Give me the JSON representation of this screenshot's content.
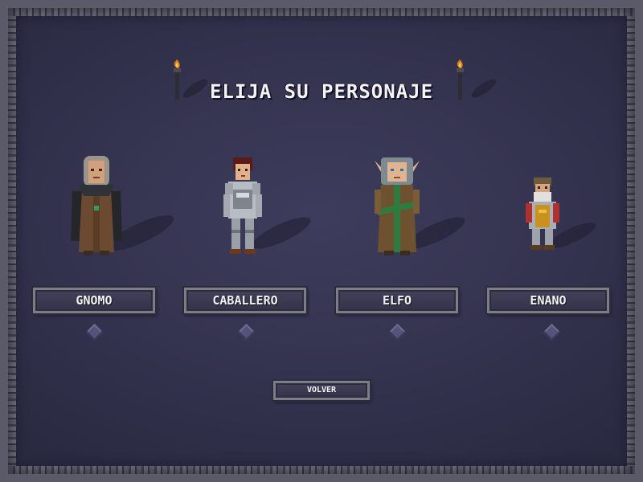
{
  "screen": {
    "title": "ELIJA SU PERSONAJE"
  },
  "characters": [
    {
      "name": "GNOMO",
      "sprite": "gnome-sprite"
    },
    {
      "name": "CABALLERO",
      "sprite": "knight-sprite"
    },
    {
      "name": "ELFO",
      "sprite": "elf-sprite"
    },
    {
      "name": "ENANO",
      "sprite": "dwarf-sprite"
    }
  ],
  "back_label": "VOLVER",
  "icons": {
    "torch": "torch-icon",
    "selector": "diamond-icon"
  },
  "colors": {
    "background": "#34334f",
    "button_fill": "#3b3a52",
    "button_border": "#7d7d8a",
    "text": "#f2f2f6",
    "diamond": "#54547a"
  }
}
